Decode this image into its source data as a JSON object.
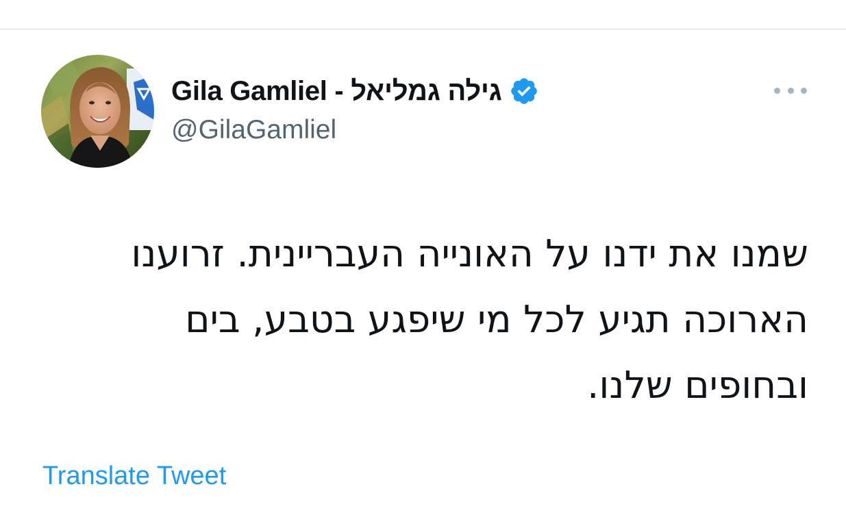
{
  "tweet": {
    "display_name": "Gila Gamliel - גילה גמליאל",
    "handle": "@GilaGamliel",
    "verified": true,
    "text_lines": [
      "שמנו את ידנו על האונייה העבריינית. זרוענו",
      "הארוכה תגיע לכל מי שיפגע בטבע, בים",
      "ובחופים שלנו."
    ],
    "translate_label": "Translate Tweet"
  },
  "icons": {
    "avatar": "profile-photo",
    "verified": "verified-badge-icon",
    "more": "more-options-icon"
  },
  "colors": {
    "accent": "#1d9bf0",
    "handle": "#536471",
    "text": "#0f1419",
    "divider": "#cfd9de"
  }
}
